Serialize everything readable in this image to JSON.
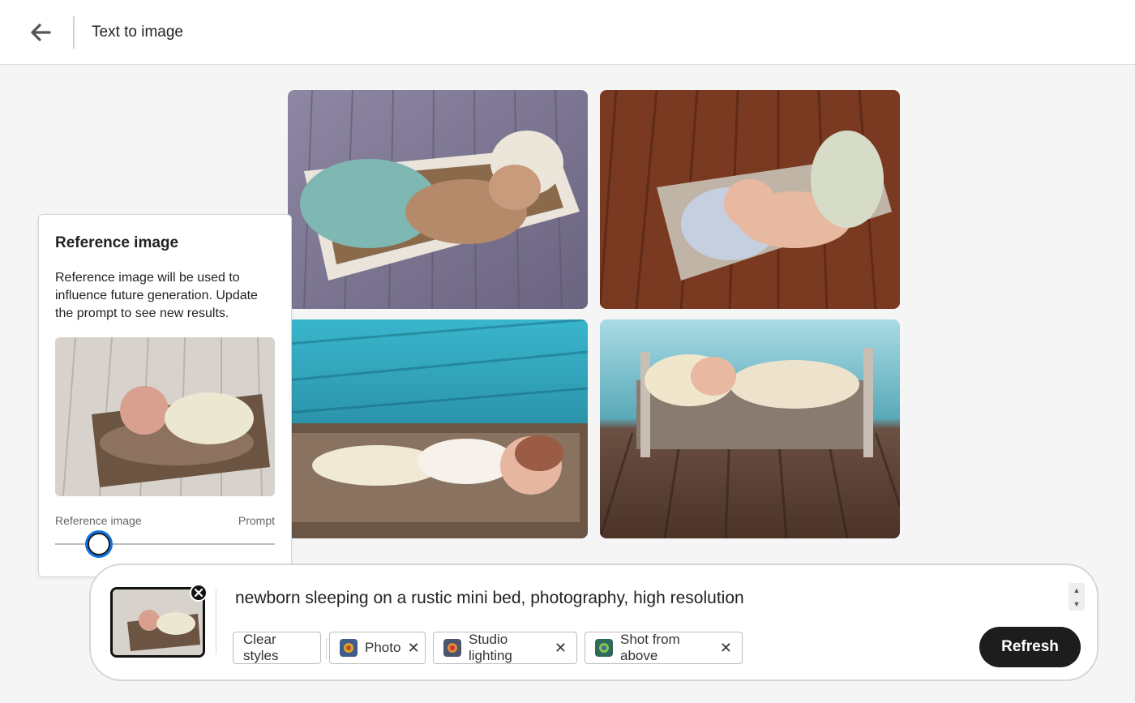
{
  "header": {
    "title": "Text to image",
    "back_icon": "arrow-left-icon"
  },
  "reference_panel": {
    "title": "Reference image",
    "description": "Reference image will be used to influence future generation. Update the prompt to see new results.",
    "slider_left_label": "Reference image",
    "slider_right_label": "Prompt",
    "slider_value": 0.2
  },
  "prompt": {
    "text": "newborn sleeping on a rustic mini bed, photography, high resolution",
    "remove_icon": "close-icon",
    "clear_styles_label": "Clear styles",
    "chips": [
      {
        "label": "Photo",
        "icon": "photo-style-icon"
      },
      {
        "label": "Studio lighting",
        "icon": "studio-lighting-icon"
      },
      {
        "label": "Shot from above",
        "icon": "shot-from-above-icon"
      }
    ],
    "refresh_label": "Refresh"
  },
  "colors": {
    "accent": "#1473e6",
    "button_dark": "#1d1d1d"
  }
}
